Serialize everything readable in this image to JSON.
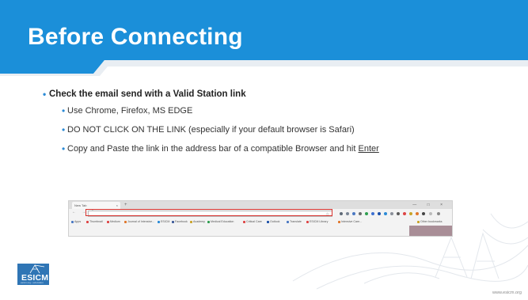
{
  "slide": {
    "title": "Before Connecting",
    "bullet_main": "Check the email send with a Valid Station link",
    "sub_bullets": [
      "Use Chrome, Firefox, MS EDGE",
      "DO NOT CLICK ON THE LINK (especially if your default browser is Safari)"
    ],
    "sub3_prefix": "Copy and Paste the link in the address bar of a compatible Browser and hit ",
    "sub3_key": "Enter",
    "bullet_glyph": "•",
    "footer_url": "www.esicm.org"
  },
  "logo": {
    "text": "ESICM",
    "subtext": "esicm.org • education",
    "color": "#2f75b5"
  },
  "browser": {
    "tab_label": "New Tab",
    "tab_close": "×",
    "new_tab": "+",
    "window_controls": "— □ ×",
    "nav_buttons": "← → ↻",
    "address_value": "",
    "star_glyph": "☆",
    "bookmarks": [
      "Apps",
      "Thumbnail",
      "Medium",
      "Journal of Intensive...",
      "ESICM",
      "Facebook",
      "Academy",
      "Medical Education",
      "Critical Care",
      "Outlook",
      "Translate",
      "ESICM Library",
      "Intensive Care...",
      "Other bookmarks"
    ]
  },
  "colors": {
    "header_blue": "#1b8fd9",
    "bullet_blue": "#2a8ad6",
    "highlight_red": "#d8332f",
    "content_strip": "#a98e97"
  }
}
